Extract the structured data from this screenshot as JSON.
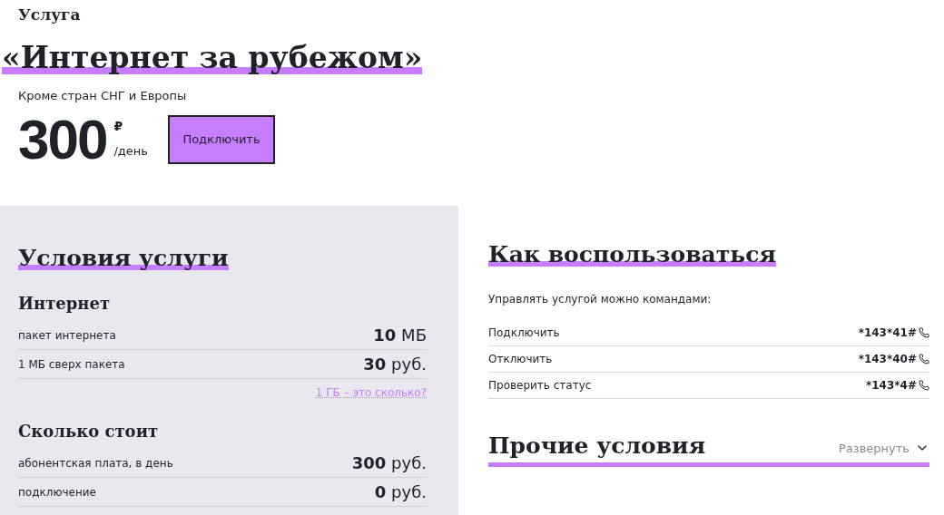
{
  "header": {
    "eyebrow": "Услуга",
    "title": "«Интернет за рубежом»",
    "subtitle": "Кроме стран СНГ и Европы",
    "price": "300",
    "currency": "₽",
    "period": "/день",
    "button": "Подключить"
  },
  "conditions": {
    "title": "Условия услуги",
    "groups": [
      {
        "title": "Интернет",
        "rows": [
          {
            "label": "пакет интернета",
            "value": "**10** МБ"
          },
          {
            "label": "1 МБ сверх пакета",
            "value": "**30** руб."
          }
        ],
        "link": "1 ГБ – это сколько?"
      },
      {
        "title": "Сколько стоит",
        "rows": [
          {
            "label": "абонентская плата, в день",
            "value": "**300** руб."
          },
          {
            "label": "подключение",
            "value": "**0** руб."
          }
        ]
      }
    ]
  },
  "usage": {
    "title": "Как воспользоваться",
    "intro": "Управлять услугой можно командами:",
    "commands": [
      {
        "label": "Подключить",
        "code": "*143*41#"
      },
      {
        "label": "Отключить",
        "code": "*143*40#"
      },
      {
        "label": "Проверить статус",
        "code": "*143*4#"
      }
    ]
  },
  "other": {
    "title": "Прочие условия",
    "toggle": "Развернуть",
    "expanded": false
  }
}
